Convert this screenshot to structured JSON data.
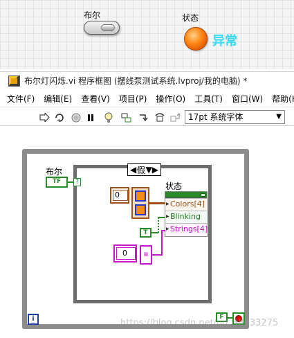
{
  "front_panel": {
    "bool_label": "布尔",
    "status_label": "状态",
    "led_text": "异常"
  },
  "window": {
    "title": "布尔灯闪烁.vi 程序框图 (摆线泵测试系统.lvproj/我的电脑)  *"
  },
  "menu": {
    "items": [
      "文件(F)",
      "编辑(E)",
      "查看(V)",
      "项目(P)",
      "操作(O)",
      "工具(T)",
      "窗口(W)",
      "帮助(H)"
    ]
  },
  "toolbar": {
    "font": "17pt 系统字体"
  },
  "diagram": {
    "bool_label": "布尔",
    "bool_terminal": "TF",
    "case_value": "假",
    "status_label": "状态",
    "property_rows": [
      "Colors[4]",
      "Blinking",
      "Strings[4]"
    ],
    "colors_index": "0",
    "strings_index": "0",
    "true_const": "T",
    "false_const": "F",
    "iteration": "i",
    "selector_term": "?"
  },
  "watermark": "https://blog.csdn.net/qq_38633275",
  "colors": {
    "bool_wire": "#2a8a2a",
    "color_wire": "#a0521a",
    "string_wire": "#c616c6",
    "led": "#ff8a1a"
  }
}
